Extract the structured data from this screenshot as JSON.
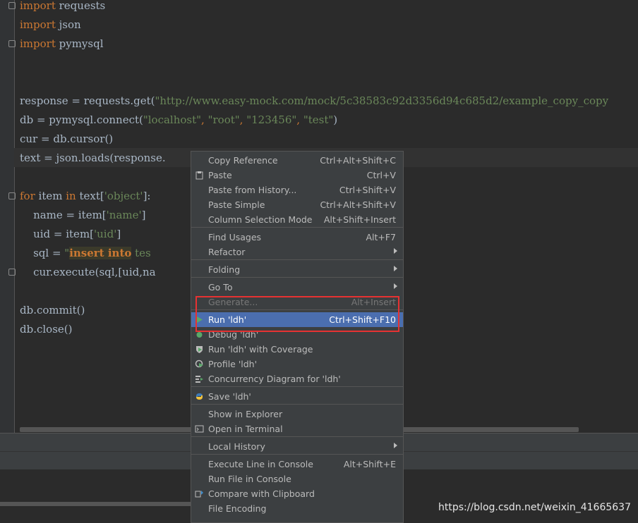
{
  "code": {
    "l1_kw": "import",
    "l1_rest": " requests",
    "l2_kw": "import",
    "l2_rest": " json",
    "l3_kw": "import",
    "l3_rest": " pymysql",
    "l4_a": "response = requests.get(",
    "l4_str": "\"http://www.easy-mock.com/mock/5c38583c92d3356d94c685d2/example_copy_copy",
    "l5_a": "db = pymysql.connect(",
    "l5_s1": "\"localhost\"",
    "l5_c1": ", ",
    "l5_s2": "\"root\"",
    "l5_c2": ", ",
    "l5_s3": "\"123456\"",
    "l5_c3": ", ",
    "l5_s4": "\"test\"",
    "l5_end": ")",
    "l6": "cur = db.cursor()",
    "l7": "text = json.loads(response.",
    "l8_kw": "for",
    "l8_a": " item ",
    "l8_kw2": "in",
    "l8_b": " text[",
    "l8_str": "'object'",
    "l8_c": "]:",
    "l9_a": "    name = item[",
    "l9_str": "'name'",
    "l9_c": "]",
    "l10_a": "    uid = item[",
    "l10_str": "'uid'",
    "l10_c": "]",
    "l11_a": "    sql = ",
    "l11_str": "\"",
    "l11_kw": "insert into",
    "l11_b": " tes",
    "l12": "    cur.execute(sql,[uid,na",
    "l13": "db.commit()",
    "l14": "db.close()"
  },
  "menu": {
    "items": [
      {
        "label": "Copy Reference",
        "shortcut": "Ctrl+Alt+Shift+C"
      },
      {
        "label": "Paste",
        "shortcut": "Ctrl+V"
      },
      {
        "label": "Paste from History...",
        "shortcut": "Ctrl+Shift+V"
      },
      {
        "label": "Paste Simple",
        "shortcut": "Ctrl+Alt+Shift+V"
      },
      {
        "label": "Column Selection Mode",
        "shortcut": "Alt+Shift+Insert"
      },
      {
        "label": "Find Usages",
        "shortcut": "Alt+F7"
      },
      {
        "label": "Refactor",
        "shortcut": ""
      },
      {
        "label": "Folding",
        "shortcut": ""
      },
      {
        "label": "Go To",
        "shortcut": ""
      },
      {
        "label": "Generate...",
        "shortcut": "Alt+Insert"
      },
      {
        "label": "Run 'ldh'",
        "shortcut": "Ctrl+Shift+F10"
      },
      {
        "label": "Debug 'ldh'",
        "shortcut": ""
      },
      {
        "label": "Run 'ldh' with Coverage",
        "shortcut": ""
      },
      {
        "label": "Profile 'ldh'",
        "shortcut": ""
      },
      {
        "label": "Concurrency Diagram for 'ldh'",
        "shortcut": ""
      },
      {
        "label": "Save 'ldh'",
        "shortcut": ""
      },
      {
        "label": "Show in Explorer",
        "shortcut": ""
      },
      {
        "label": "Open in Terminal",
        "shortcut": ""
      },
      {
        "label": "Local History",
        "shortcut": ""
      },
      {
        "label": "Execute Line in Console",
        "shortcut": "Alt+Shift+E"
      },
      {
        "label": "Run File in Console",
        "shortcut": ""
      },
      {
        "label": "Compare with Clipboard",
        "shortcut": ""
      },
      {
        "label": "File Encoding",
        "shortcut": ""
      }
    ]
  },
  "watermark": "https://blog.csdn.net/weixin_41665637",
  "colors": {
    "keyword": "#cc7832",
    "string": "#6a8759",
    "selected": "#4b6eaf",
    "highlight_box": "#e63232"
  }
}
